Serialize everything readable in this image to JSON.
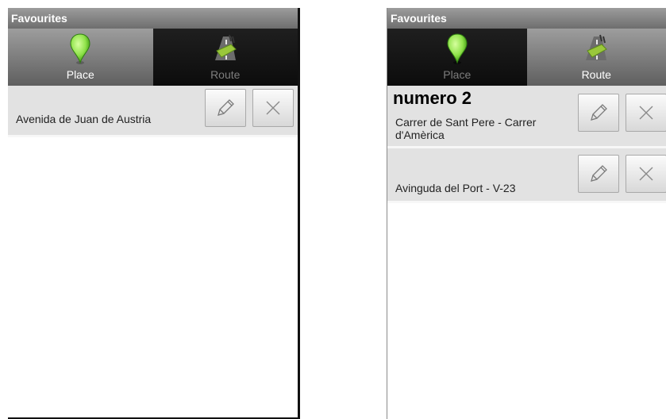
{
  "screens": [
    {
      "title": "Favourites",
      "tabs": [
        {
          "label": "Place",
          "icon": "map-pin-icon",
          "active": true
        },
        {
          "label": "Route",
          "icon": "route-icon",
          "active": false
        }
      ],
      "items": [
        {
          "name": "",
          "address": "Avenida de Juan de Austria"
        }
      ]
    },
    {
      "title": "Favourites",
      "tabs": [
        {
          "label": "Place",
          "icon": "map-pin-icon",
          "active": false
        },
        {
          "label": "Route",
          "icon": "route-icon",
          "active": true
        }
      ],
      "items": [
        {
          "name": "numero 2",
          "address": "Carrer de Sant Pere  - Carrer d'Amèrica"
        },
        {
          "name": "",
          "address": "Avinguda del Port  - V-23"
        }
      ]
    }
  ],
  "colors": {
    "pin": "#8fe24a",
    "route_accent": "#9ac73b",
    "list_row_bg": "#e2e2e2",
    "title_bar": "#8a8a8a"
  }
}
